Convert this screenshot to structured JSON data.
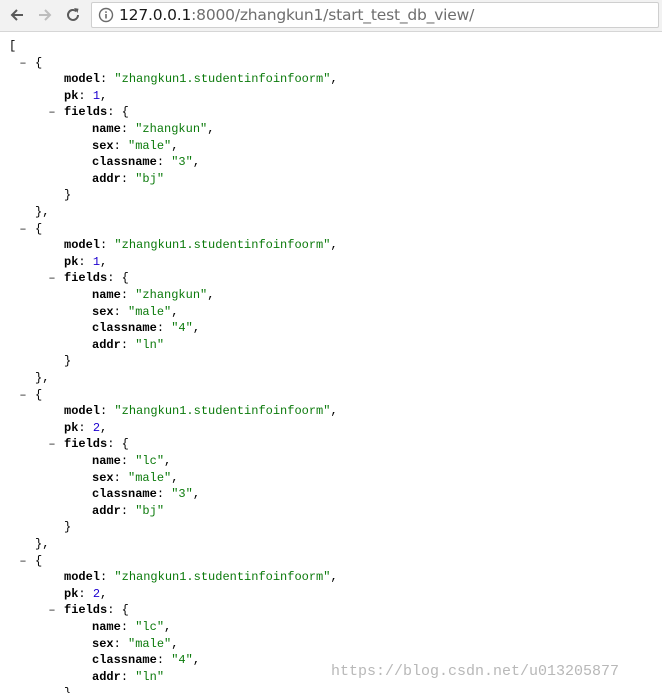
{
  "browser": {
    "url_host": "127.0.0.1",
    "url_rest": ":8000/zhangkun1/start_test_db_view/"
  },
  "json_view": {
    "open_bracket": "[",
    "toggle_symbol": "–",
    "records": [
      {
        "model": "\"zhangkun1.studentinfoinfoorm\"",
        "pk": "1",
        "name": "\"zhangkun\"",
        "sex": "\"male\"",
        "classname": "\"3\"",
        "addr": "\"bj\""
      },
      {
        "model": "\"zhangkun1.studentinfoinfoorm\"",
        "pk": "1",
        "name": "\"zhangkun\"",
        "sex": "\"male\"",
        "classname": "\"4\"",
        "addr": "\"ln\""
      },
      {
        "model": "\"zhangkun1.studentinfoinfoorm\"",
        "pk": "2",
        "name": "\"lc\"",
        "sex": "\"male\"",
        "classname": "\"3\"",
        "addr": "\"bj\""
      },
      {
        "model": "\"zhangkun1.studentinfoinfoorm\"",
        "pk": "2",
        "name": "\"lc\"",
        "sex": "\"male\"",
        "classname": "\"4\"",
        "addr": "\"ln\""
      }
    ],
    "keys": {
      "model": "model",
      "pk": "pk",
      "fields": "fields",
      "name": "name",
      "sex": "sex",
      "classname": "classname",
      "addr": "addr"
    }
  },
  "watermark": "https://blog.csdn.net/u013205877"
}
